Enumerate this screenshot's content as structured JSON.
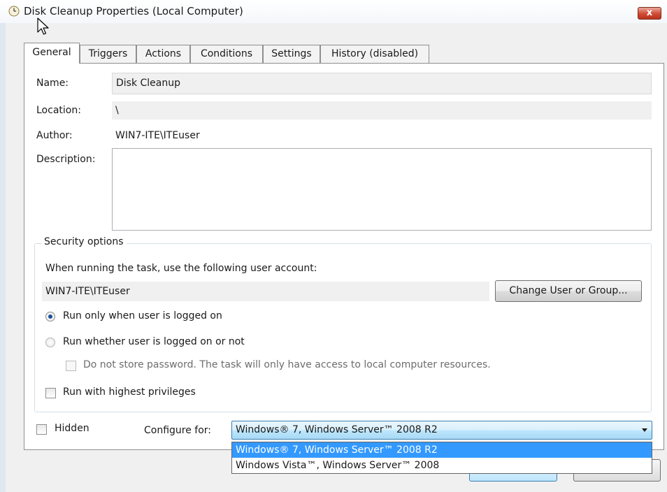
{
  "window": {
    "title": "Disk Cleanup Properties (Local Computer)",
    "close_label": "x",
    "icon": "clock-icon"
  },
  "tabs": [
    {
      "label": "General",
      "active": true
    },
    {
      "label": "Triggers"
    },
    {
      "label": "Actions"
    },
    {
      "label": "Conditions"
    },
    {
      "label": "Settings"
    },
    {
      "label": "History (disabled)"
    }
  ],
  "general": {
    "name_label": "Name:",
    "name_value": "Disk Cleanup",
    "location_label": "Location:",
    "location_value": "\\",
    "author_label": "Author:",
    "author_value": "WIN7-ITE\\ITEuser",
    "description_label": "Description:",
    "description_value": ""
  },
  "security": {
    "legend": "Security options",
    "account_prompt": "When running the task, use the following user account:",
    "account_value": "WIN7-ITE\\ITEuser",
    "change_button": "Change User or Group...",
    "radio_logged_on": "Run only when user is logged on",
    "radio_logged_on_checked": true,
    "radio_whether": "Run whether user is logged on or not",
    "radio_whether_checked": false,
    "no_store_password": "Do not store password.  The task will only have access to local computer resources.",
    "highest_privileges": "Run with highest privileges"
  },
  "footer": {
    "hidden_label": "Hidden",
    "configure_label": "Configure for:",
    "configure_value": "Windows® 7, Windows Server™ 2008 R2",
    "options": [
      "Windows® 7, Windows Server™ 2008 R2",
      "Windows Vista™, Windows Server™ 2008"
    ]
  },
  "colors": {
    "selection": "#3399ff",
    "close_button": "#cf4b33",
    "radio_dot": "#1c4e9c"
  }
}
